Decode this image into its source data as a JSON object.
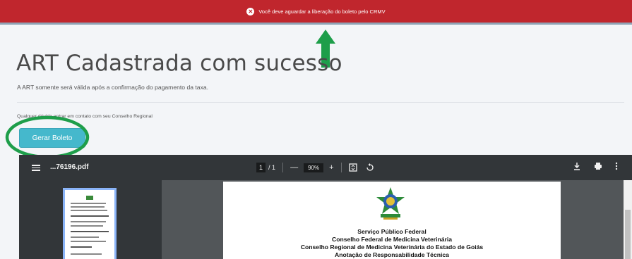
{
  "alert": {
    "message": "Você deve aguardar a liberação do boleto pelo CRMV",
    "icon": "close-circle-icon",
    "color": "#c0262d"
  },
  "page": {
    "title": "ART Cadastrada com sucesso",
    "subtitle": "A ART somente será válida após a confirmação do pagamento da taxa.",
    "contact_note": "Qualquer dúvida entrar em contato com seu Conselho Regional",
    "generate_button": "Gerar Boleto",
    "accent_color": "#45b8cc"
  },
  "pdf": {
    "filename": "...76196.pdf",
    "page_current": "1",
    "page_separator": "/",
    "page_total": "1",
    "zoom_out": "—",
    "zoom": "90%",
    "zoom_in": "+",
    "fit_icon": "fit-page-icon",
    "rotate_icon": "rotate-icon",
    "download_icon": "download-icon",
    "print_icon": "print-icon",
    "more_icon": "more-vert-icon",
    "doc_lines": [
      "Serviço Público Federal",
      "Conselho Federal de Medicina Veterinária",
      "Conselho Regional de Medicina Veterinária do Estado de Goiás",
      "Anotação de Responsabilidade Técnica"
    ]
  },
  "annotations": {
    "arrow_color": "#1e9e4a",
    "circle_color": "#1e9e4a"
  }
}
